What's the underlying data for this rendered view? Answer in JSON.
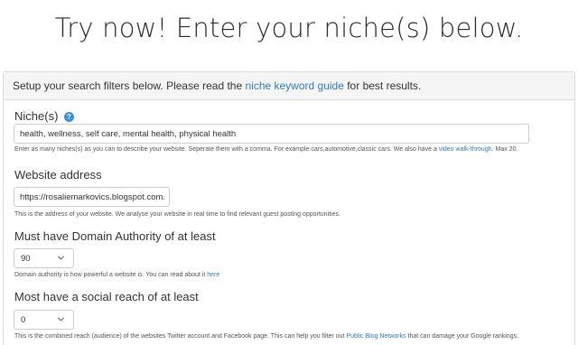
{
  "hero": {
    "title": "Try now! Enter your niche(s) below."
  },
  "panel": {
    "intro_prefix": "Setup your search filters below. Please read the ",
    "intro_link": "niche keyword guide",
    "intro_suffix": " for best results."
  },
  "niches": {
    "label": "Niche(s)",
    "help_glyph": "?",
    "value": "health, wellness, self care, mental health, physical health",
    "hint_prefix": "Enter as many niches(s) as you can to describe your website. Seperate them with a comma. For example cars,automotive,classic cars. We also have a ",
    "hint_link": "video walk-through",
    "hint_suffix": ". Max 20."
  },
  "website": {
    "label": "Website address",
    "value": "https://rosaliemarkovics.blogspot.com.",
    "hint": "This is the address of your website. We analyse your website in real time to find relevant guest posting opportunities."
  },
  "domain_authority": {
    "label": "Must have Domain Authority of at least",
    "selected": "90",
    "hint_prefix": "Domain authority is how powerful a website is. You can read about it ",
    "hint_link": "here"
  },
  "social_reach": {
    "label": "Most have a social reach of at least",
    "selected": "0",
    "hint_prefix": "This is the combined reach (audience) of the websites Twitter account and Facebook page. This can help you filter out ",
    "hint_link": "Public Blog Networks",
    "hint_suffix": " that can damage your Google rankings."
  },
  "colors": {
    "link": "#337ab7",
    "help_icon": "#3c8dde",
    "panel_header_bg": "#f5f5f5",
    "border": "#dcdcdc"
  },
  "icons": {
    "help": "question-circle-icon",
    "dropdown": "chevron-down-icon"
  }
}
